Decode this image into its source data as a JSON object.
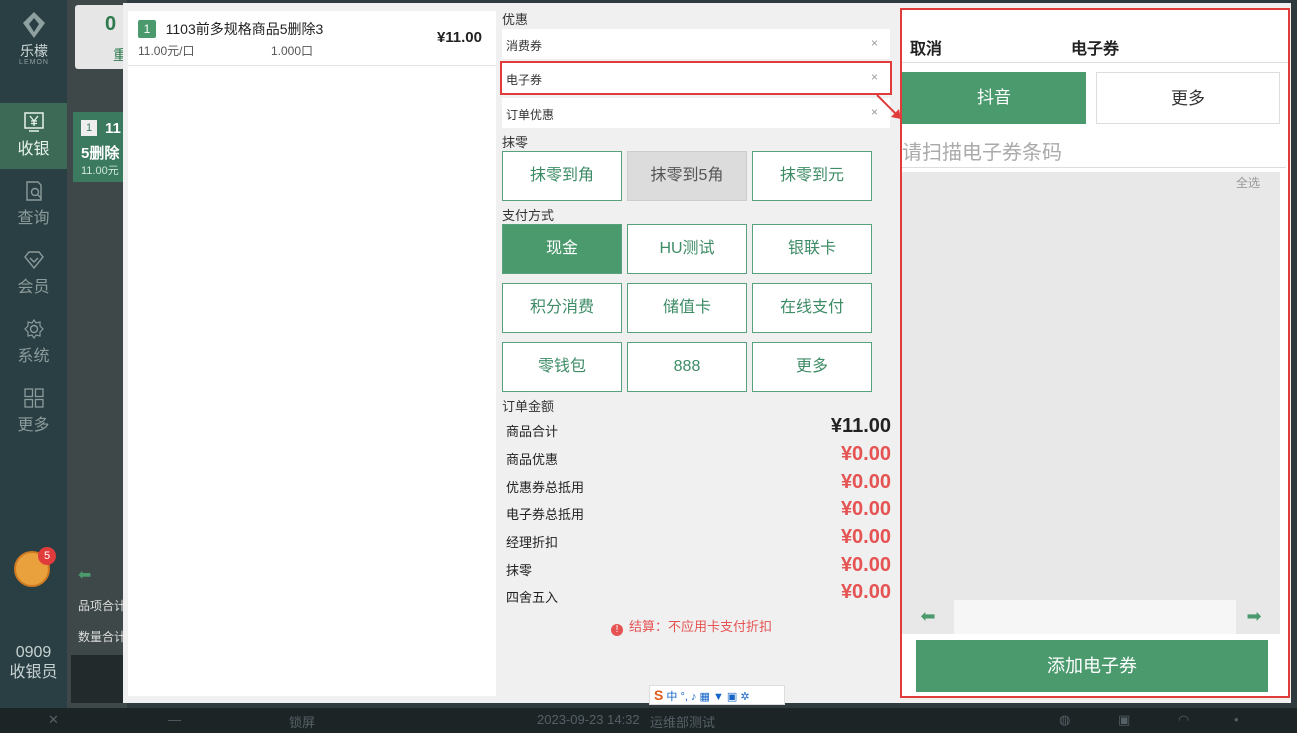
{
  "sidebar": {
    "logo_text": "乐檬",
    "logo_sub": "LEMON",
    "items": [
      {
        "label": "收银",
        "icon": "yen-icon"
      },
      {
        "label": "查询",
        "icon": "search-doc-icon"
      },
      {
        "label": "会员",
        "icon": "diamond-icon"
      },
      {
        "label": "系统",
        "icon": "gear-icon"
      },
      {
        "label": "更多",
        "icon": "grid-icon"
      }
    ],
    "badge_count": "5",
    "user_id": "0909",
    "user_role": "收银员"
  },
  "order": {
    "items": [
      {
        "index": "1",
        "name": "1103前多规格商品5删除3",
        "unit_price": "11.00元/口",
        "qty": "1.000口",
        "price": "¥11.00"
      }
    ]
  },
  "discount": {
    "section_title": "优惠",
    "rows": [
      {
        "label": "消费券",
        "clear": "×"
      },
      {
        "label": "电子券",
        "clear": "×"
      },
      {
        "label": "订单优惠",
        "clear": "×"
      }
    ]
  },
  "rounding": {
    "section_title": "抹零",
    "options": [
      "抹零到角",
      "抹零到5角",
      "抹零到元"
    ]
  },
  "payment": {
    "section_title": "支付方式",
    "options": [
      "现金",
      "HU测试",
      "银联卡",
      "积分消费",
      "储值卡",
      "在线支付",
      "零钱包",
      "888",
      "更多"
    ]
  },
  "amounts": {
    "section_title": "订单金额",
    "rows": [
      {
        "label": "商品合计",
        "value": "¥11.00"
      },
      {
        "label": "商品优惠",
        "value": "¥0.00"
      },
      {
        "label": "优惠券总抵用",
        "value": "¥0.00"
      },
      {
        "label": "电子券总抵用",
        "value": "¥0.00"
      },
      {
        "label": "经理折扣",
        "value": "¥0.00"
      },
      {
        "label": "抹零",
        "value": "¥0.00"
      },
      {
        "label": "四舍五入",
        "value": "¥0.00"
      }
    ],
    "note": "结算：不应用卡支付折扣"
  },
  "ime": {
    "logo": "S",
    "text": "中 °, ♪ ▦ ▼ ▣ ✲"
  },
  "ecoupon": {
    "cancel": "取消",
    "title": "电子券",
    "tabs": [
      "抖音",
      "更多"
    ],
    "placeholder": "请扫描电子券条码",
    "select_all": "全选",
    "add_button": "添加电子券"
  },
  "background": {
    "card_a": "0",
    "card_a_sub": "重",
    "card_b_idx": "1",
    "card_b_num": "11",
    "card_b_name": "5删除",
    "card_b_sub": "11.00元",
    "summary_a": "品项合计",
    "summary_b": "数量合计"
  },
  "taskbar": {
    "close": "✕",
    "minimize": "—",
    "lock": "锁屏",
    "datetime": "2023-09-23 14:32",
    "department": "运维部测试"
  },
  "colors": {
    "accent": "#4a9a6d",
    "warn": "#e55353",
    "highlight": "#e03c3c"
  }
}
